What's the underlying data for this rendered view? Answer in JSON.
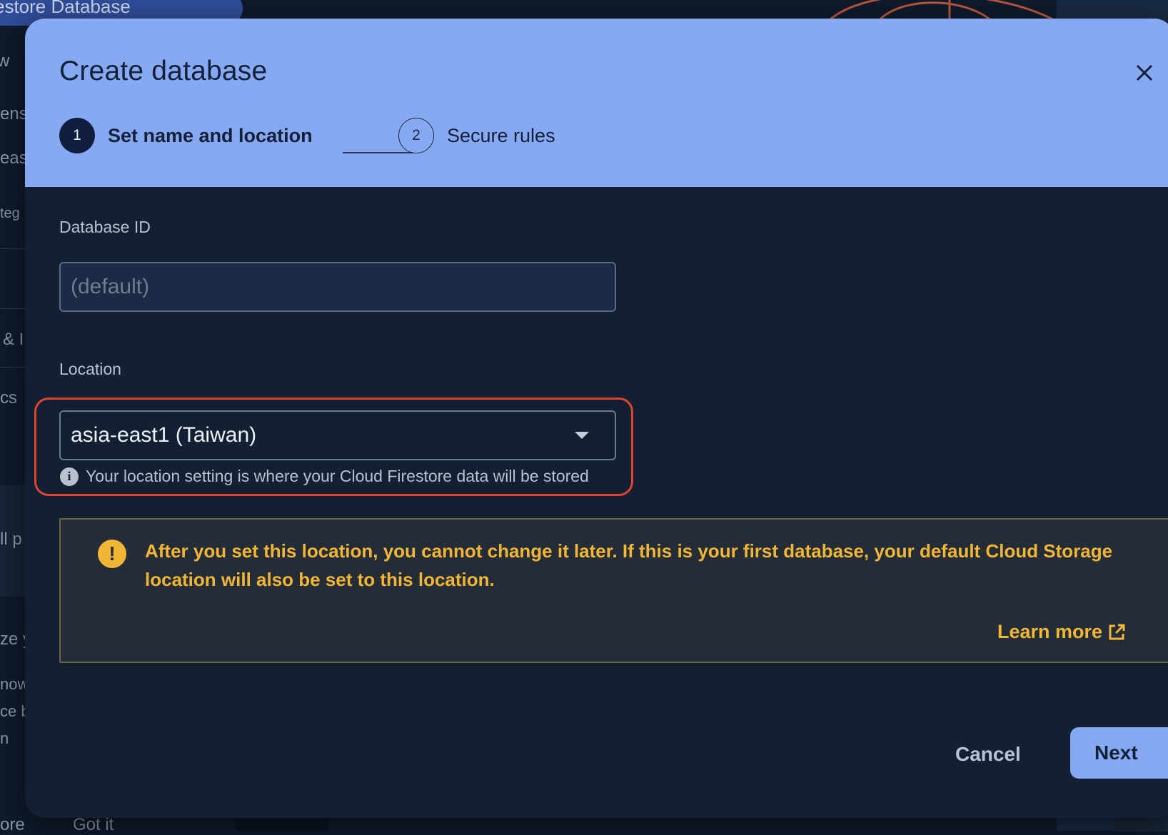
{
  "background": {
    "header_title": "estore Database",
    "sidebar_fragments": [
      "w",
      "ens",
      "eas",
      "teg",
      "& I",
      "cs",
      "ll p",
      "ze y",
      "now",
      "ce b",
      "n",
      "ore"
    ],
    "bottom_link": "Got it"
  },
  "dialog": {
    "title": "Create database",
    "close_icon": "close-icon",
    "stepper": {
      "steps": [
        {
          "number": "1",
          "label": "Set name and location",
          "active": true
        },
        {
          "number": "2",
          "label": "Secure rules",
          "active": false
        }
      ]
    },
    "database_id": {
      "label": "Database ID",
      "value": "",
      "placeholder": "(default)"
    },
    "location": {
      "label": "Location",
      "selected": "asia-east1 (Taiwan)",
      "hint": "Your location setting is where your Cloud Firestore data will be stored",
      "highlighted": true
    },
    "warning": {
      "icon": "!",
      "text": "After you set this location, you cannot change it later. If this is your first database, your default Cloud Storage location will also be set to this location.",
      "link_label": "Learn more"
    },
    "actions": {
      "cancel_label": "Cancel",
      "next_label": "Next"
    }
  },
  "colors": {
    "header_bg": "#86a9f2",
    "dialog_bg": "#132033",
    "highlight_border": "#e0432f",
    "warning_text": "#f2b636"
  }
}
